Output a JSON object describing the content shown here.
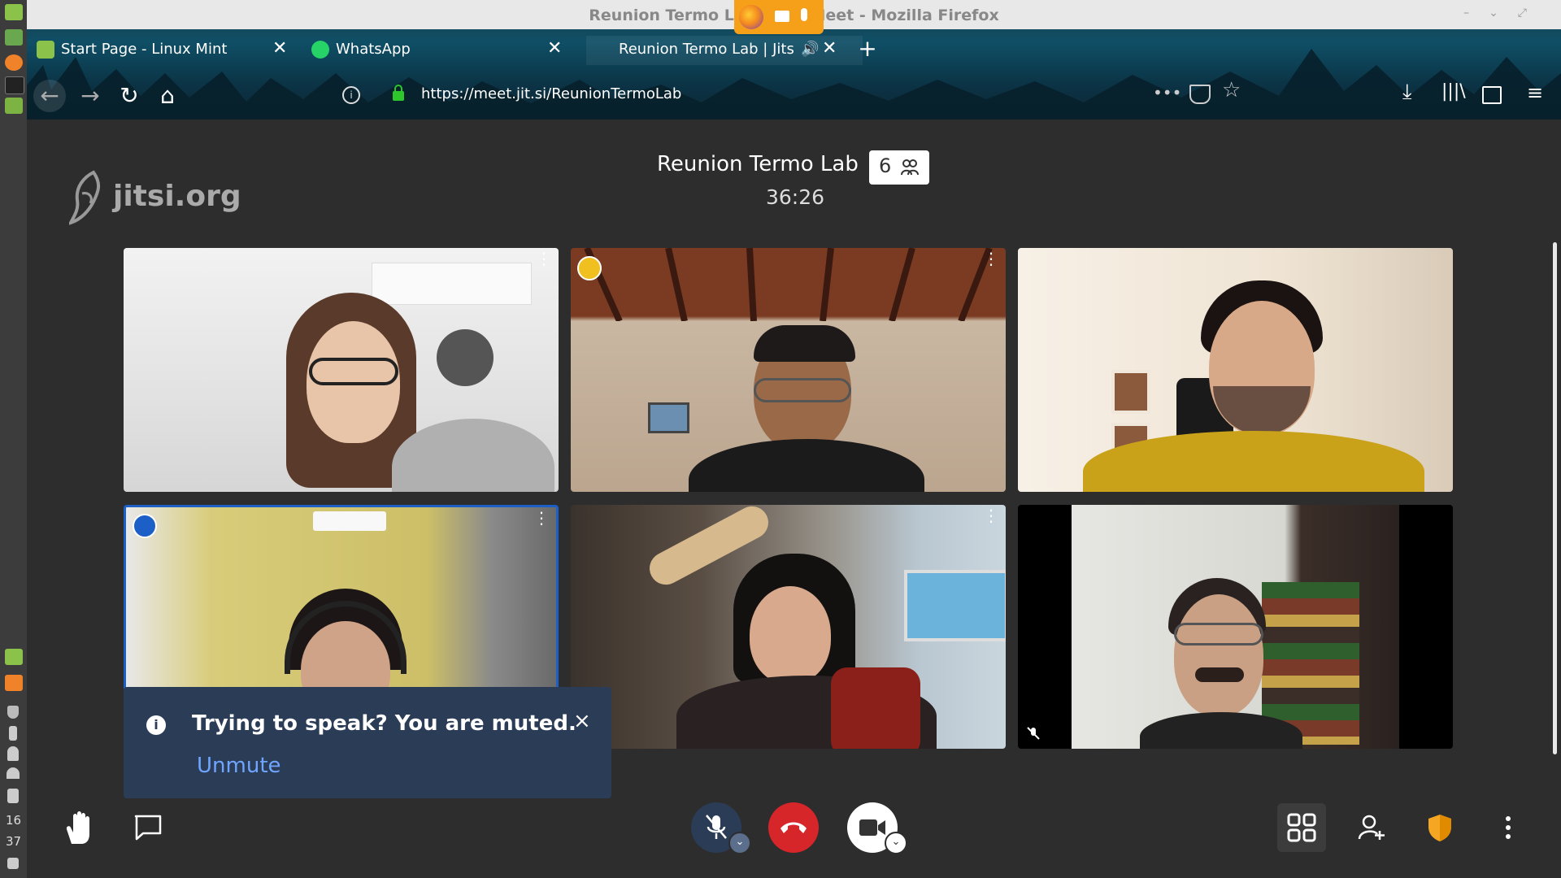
{
  "window": {
    "title": "Reunion Termo Lab | Jitsi Meet - Mozilla Firefox"
  },
  "panel": {
    "clock_hour": "16",
    "clock_min": "37"
  },
  "tabs": [
    {
      "label": "Start Page - Linux Mint"
    },
    {
      "label": "WhatsApp"
    },
    {
      "label": "Reunion Termo Lab | Jitsi"
    }
  ],
  "toolbar": {
    "url": "https://meet.jit.si/ReunionTermoLab",
    "overflow": "•••"
  },
  "conference": {
    "title": "Reunion Termo Lab",
    "participant_count": "6",
    "timer": "36:26",
    "logo_text": "jitsi.org"
  },
  "notification": {
    "message": "Trying to speak? You are muted.",
    "action": "Unmute",
    "close": "×",
    "info": "i"
  },
  "colors": {
    "accent": "#6fa5ff",
    "hangup": "#d6262a",
    "active_border": "#1c5fc6",
    "toast_bg": "#2b3c57"
  },
  "icons": [
    "raise-hand-icon",
    "chat-icon",
    "mic-muted-icon",
    "hangup-icon",
    "camera-icon",
    "tile-view-icon",
    "invite-icon",
    "security-shield-icon",
    "more-icon"
  ]
}
